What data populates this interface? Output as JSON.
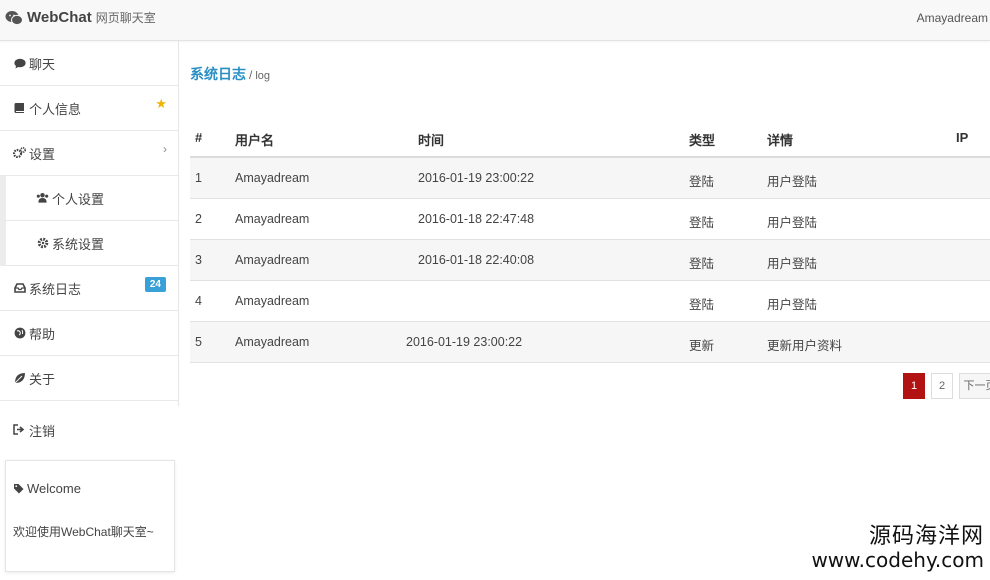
{
  "navbar": {
    "brand_name": "WebChat",
    "brand_sub": "网页聊天室",
    "user": "Amayadream"
  },
  "sidebar": {
    "items": [
      {
        "label": "聊天",
        "icon": "comment-icon"
      },
      {
        "label": "个人信息",
        "icon": "book-icon"
      },
      {
        "label": "设置",
        "icon": "cogs-icon"
      },
      {
        "label": "个人设置",
        "icon": "users-icon"
      },
      {
        "label": "系统设置",
        "icon": "gear-icon"
      },
      {
        "label": "系统日志",
        "icon": "inbox-icon",
        "badge": "24"
      },
      {
        "label": "帮助",
        "icon": "globe-icon"
      },
      {
        "label": "关于",
        "icon": "leaf-icon"
      }
    ],
    "logout": "注销"
  },
  "welcome": {
    "title": "Welcome",
    "text": "欢迎使用WebChat聊天室~"
  },
  "breadcrumb": {
    "main": "系统日志",
    "sep": "/",
    "sub": "log"
  },
  "table": {
    "headers": [
      "#",
      "用户名",
      "时间",
      "类型",
      "详情",
      "IP"
    ],
    "rows": [
      {
        "num": "1",
        "user": "Amayadream",
        "time": "2016-01-19 23:00:22",
        "type": "登陆",
        "detail": "用户登陆",
        "ip": ""
      },
      {
        "num": "2",
        "user": "Amayadream",
        "time": "2016-01-18 22:47:48",
        "type": "登陆",
        "detail": "用户登陆",
        "ip": ""
      },
      {
        "num": "3",
        "user": "Amayadream",
        "time": "2016-01-18 22:40:08",
        "type": "登陆",
        "detail": "用户登陆",
        "ip": ""
      },
      {
        "num": "4",
        "user": "Amayadream",
        "time": "",
        "type": "登陆",
        "detail": "用户登陆",
        "ip": ""
      },
      {
        "num": "5",
        "user": "Amayadream",
        "time": "2016-01-19 23:00:22",
        "type": "更新",
        "detail": "更新用户资料",
        "ip": ""
      }
    ]
  },
  "pagination": {
    "pages": [
      "1",
      "2"
    ],
    "active": "1",
    "next": "下一页"
  },
  "watermark": {
    "line1": "源码海洋网",
    "line2": "www.codehy.com"
  },
  "colors": {
    "accent": "#2a8fc4",
    "badge": "#3aa1d8",
    "active_page": "#b31212",
    "star": "#f0b400"
  }
}
